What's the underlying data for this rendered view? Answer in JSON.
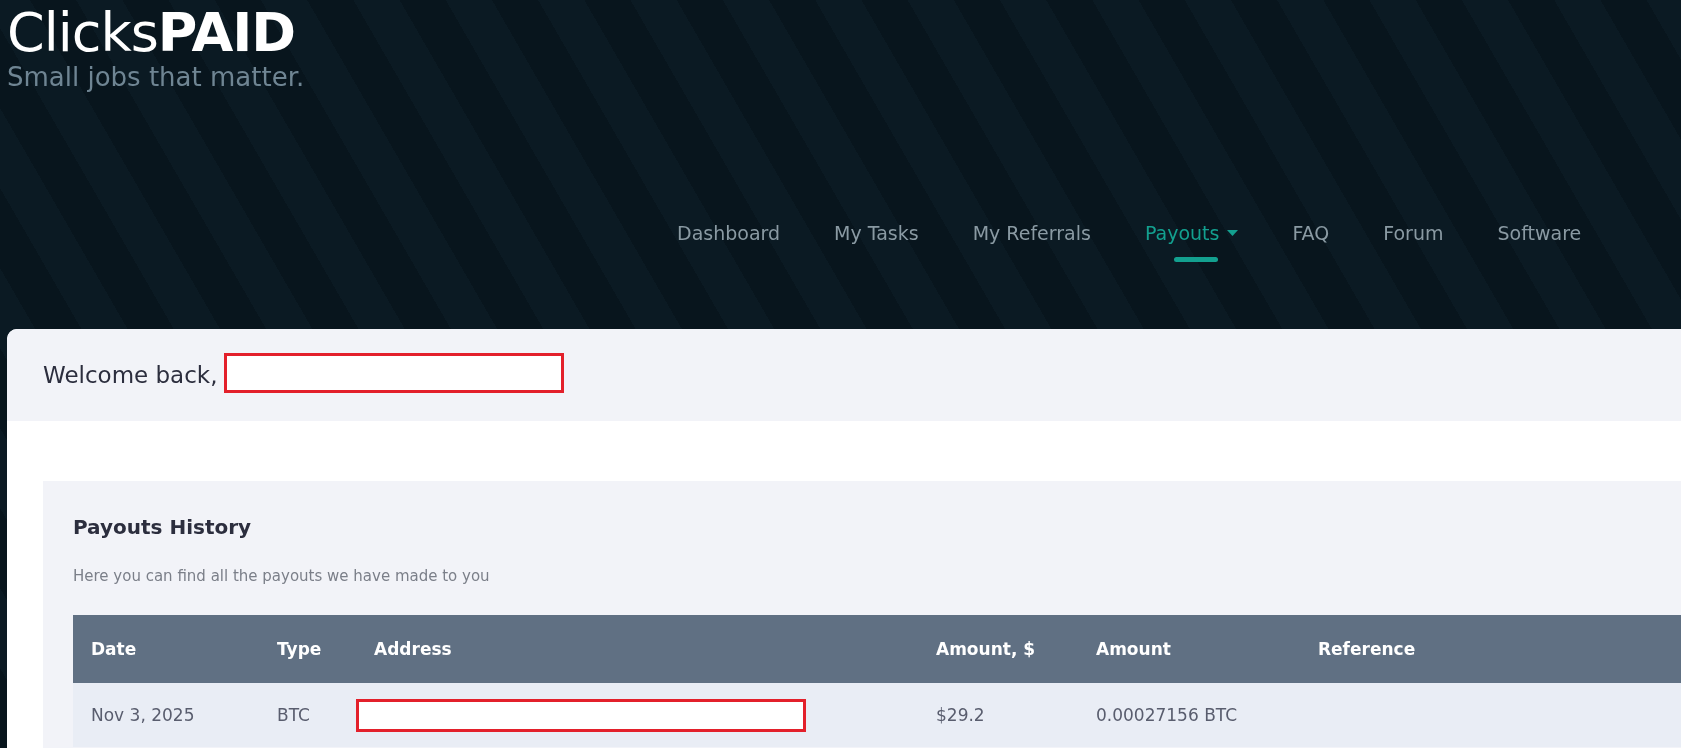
{
  "brand": {
    "logo": "Clicks**PAID**",
    "tagline": "Small jobs that matter."
  },
  "nav": {
    "items": [
      {
        "label": "Dashboard",
        "selected": false,
        "has_dropdown": false
      },
      {
        "label": "My Tasks",
        "selected": false,
        "has_dropdown": false
      },
      {
        "label": "My Referrals",
        "selected": false,
        "has_dropdown": false
      },
      {
        "label": "Payouts",
        "selected": true,
        "has_dropdown": true
      },
      {
        "label": "FAQ",
        "selected": false,
        "has_dropdown": false
      },
      {
        "label": "Forum",
        "selected": false,
        "has_dropdown": false
      },
      {
        "label": "Software",
        "selected": false,
        "has_dropdown": false
      }
    ]
  },
  "welcome": {
    "text": "Welcome back,",
    "name_redacted": true
  },
  "payouts": {
    "title": "Payouts History",
    "subtitle": "Here you can find all the payouts we have made to you",
    "table": {
      "columns": [
        "Date",
        "Type",
        "Address",
        "Amount, $",
        "Amount",
        "Reference"
      ],
      "rows": [
        {
          "cells": [
            "Nov 3, 2025",
            "BTC",
            "",
            "$29.2",
            "0.00027156 BTC",
            ""
          ],
          "address_redacted": true
        }
      ]
    }
  }
}
